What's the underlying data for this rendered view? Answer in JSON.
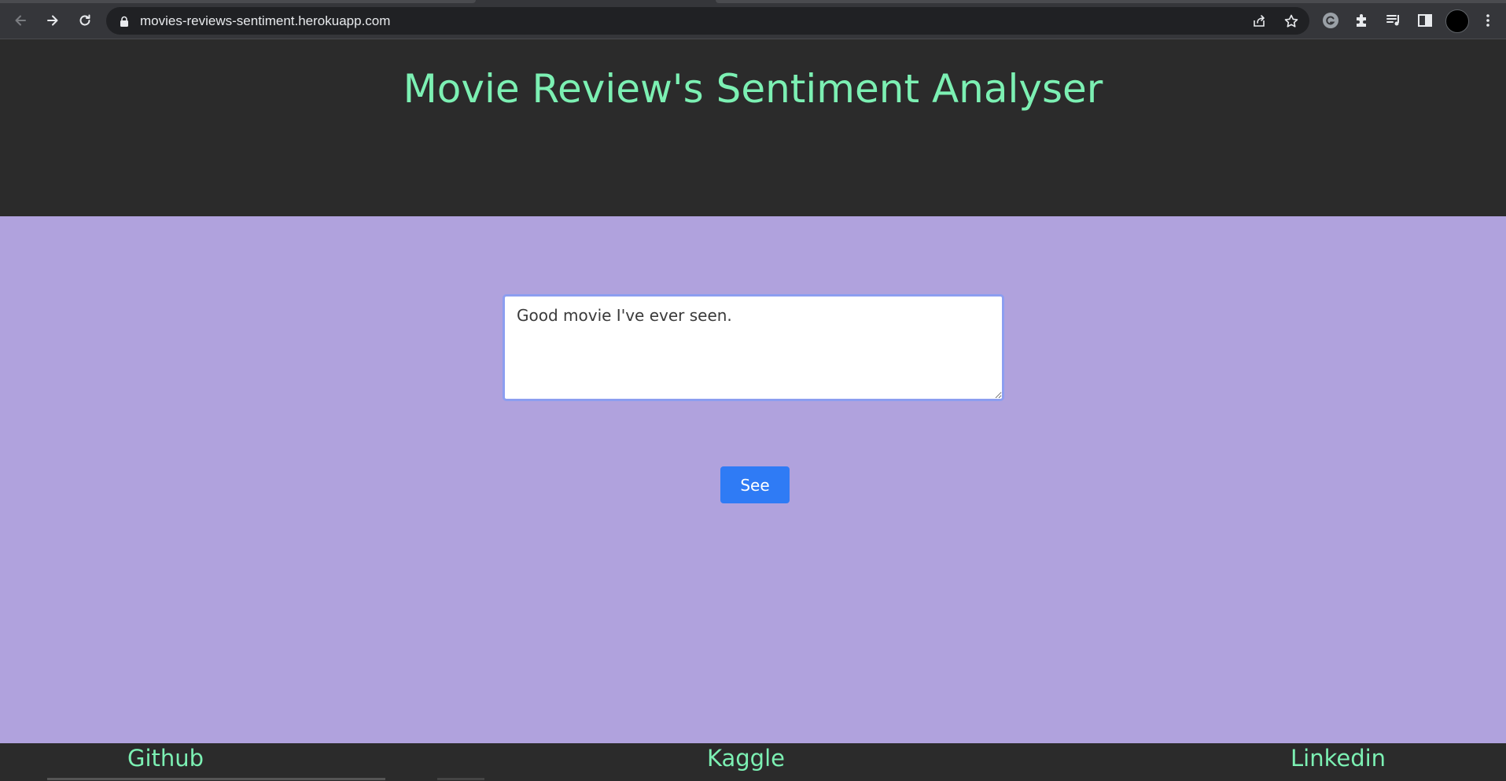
{
  "browser": {
    "url": "movies-reviews-sentiment.herokuapp.com",
    "icons": {
      "back": "back-arrow-icon",
      "forward": "forward-arrow-icon",
      "reload": "reload-icon",
      "lock": "lock-icon",
      "share": "share-icon",
      "bookmark": "star-icon",
      "extension_g": "grammarly-icon",
      "extensions": "puzzle-icon",
      "media": "media-playlist-icon",
      "side_panel": "side-panel-icon",
      "profile": "avatar",
      "menu": "kebab-menu-icon"
    }
  },
  "header": {
    "title": "Movie Review's Sentiment Analyser"
  },
  "form": {
    "review_text": "Good movie I've ever seen.",
    "submit_label": "See"
  },
  "footer": {
    "links": [
      {
        "label": "Github"
      },
      {
        "label": "Kaggle"
      },
      {
        "label": "Linkedin"
      }
    ]
  },
  "colors": {
    "title_color": "#7cf0b3",
    "header_bg": "#2b2b2b",
    "main_bg": "#b0a2dd",
    "button_bg": "#2f7bf5",
    "textarea_border": "#8c9ef0"
  }
}
